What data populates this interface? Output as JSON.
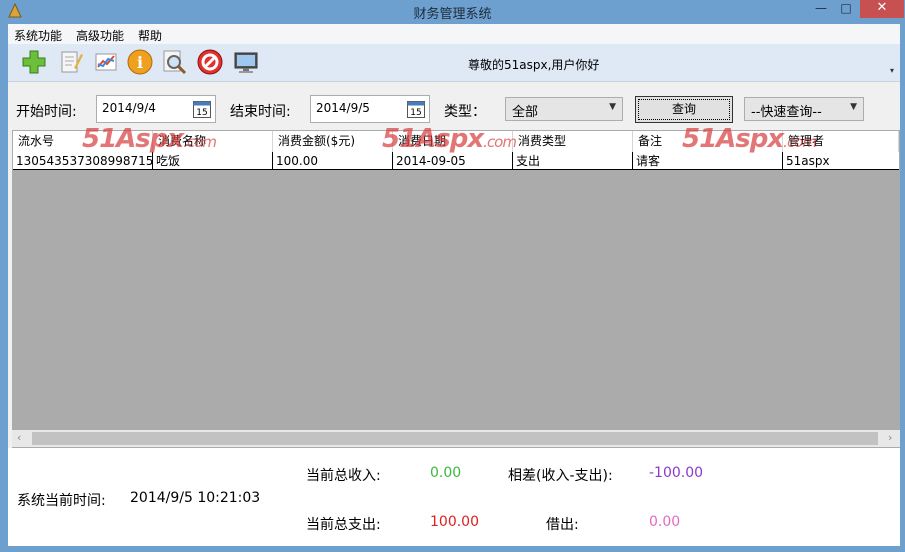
{
  "window": {
    "title": "财务管理系统",
    "minimize": "—",
    "maximize": "□",
    "close": "✕"
  },
  "menu": [
    "系统功能",
    "高级功能",
    "帮助"
  ],
  "toolbar": {
    "icons": [
      "add-icon",
      "edit-icon",
      "chart-icon",
      "info-icon",
      "search-icon",
      "stop-icon",
      "monitor-icon"
    ],
    "greeting": "尊敬的51aspx,用户你好"
  },
  "filters": {
    "start_label": "开始时间:",
    "start_value": "2014/9/4",
    "end_label": "结束时间:",
    "end_value": "2014/9/5",
    "type_label": "类型：",
    "type_value": "全部",
    "query_label": "查询",
    "quick_query": "--快速查询--",
    "calendar_day": "15"
  },
  "grid": {
    "columns": [
      "流水号",
      "消费名称",
      "消费金额($元)",
      "消费日期",
      "消费类型",
      "备注",
      "管理者"
    ],
    "rows": [
      [
        "130543537308998715",
        "吃饭",
        "100.00",
        "2014-09-05",
        "支出",
        "请客",
        "51aspx"
      ]
    ]
  },
  "watermark": {
    "main": "51Aspx",
    "sub": ".com"
  },
  "status": {
    "time_label": "系统当前时间:",
    "time_value": "2014/9/5 10:21:03",
    "income_label": "当前总收入:",
    "income_value": "0.00",
    "diff_label": "相差(收入-支出):",
    "diff_value": "-100.00",
    "expense_label": "当前总支出:",
    "expense_value": "100.00",
    "borrow_label": "借出:",
    "borrow_value": "0.00"
  },
  "colors": {
    "income": "#3cb83c",
    "diff": "#8b3ac7",
    "expense": "#e02020",
    "borrow": "#e46ac0",
    "titlebar": "#6ea0cf"
  }
}
